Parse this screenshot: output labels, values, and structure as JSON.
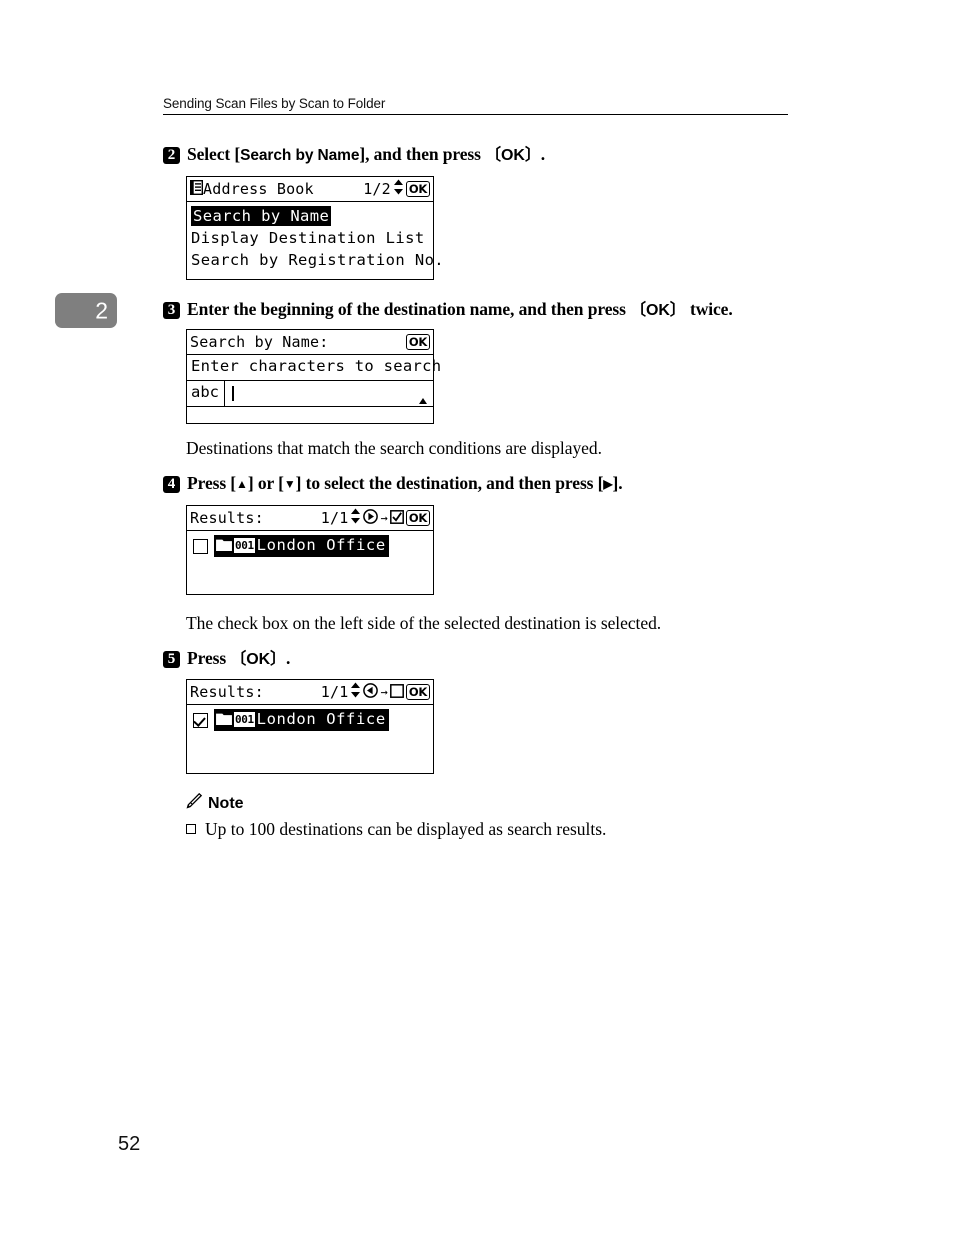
{
  "header": {
    "running_title": "Sending Scan Files by Scan to Folder"
  },
  "chapter_tab": {
    "number": "2"
  },
  "page_number": "52",
  "steps": [
    {
      "number": "2",
      "text_parts": {
        "a": "Select [",
        "b": "Search by Name",
        "c": "], and then press ",
        "d": "OK",
        "e": "."
      }
    },
    {
      "number": "3",
      "text_parts": {
        "a": "Enter the beginning of the destination name, and then press ",
        "d": "OK",
        "e": " twice."
      }
    },
    {
      "number": "4",
      "text_parts": {
        "a": "Press [",
        "up": "▲",
        "b": "] or [",
        "down": "▼",
        "c": "] to select the destination, and then press [",
        "right": "▶",
        "e": "]."
      }
    },
    {
      "number": "5",
      "text_parts": {
        "a": "Press ",
        "d": "OK",
        "e": "."
      }
    }
  ],
  "paragraphs": {
    "after_step3": "Destinations that match the search conditions are displayed.",
    "after_step4": "The check box on the left side of the selected destination is selected."
  },
  "lcd_address_book": {
    "icon": "address-book-icon",
    "title": "Address Book",
    "page_indicator": "1/2",
    "updown_icon": "up-down-arrow-icon",
    "ok_key": "OK",
    "rows": [
      {
        "label": "Search by Name",
        "selected": true
      },
      {
        "label": "Display Destination List",
        "selected": false
      },
      {
        "label": "Search by Registration No.",
        "selected": false
      }
    ]
  },
  "lcd_search_by_name": {
    "title": "Search by Name:",
    "ok_key": "OK",
    "prompt": "Enter characters to search",
    "input_mode": "abc",
    "input_value": "",
    "scroll_icon": "scroll-up-triangle-icon"
  },
  "lcd_results_unchecked": {
    "title": "Results:",
    "page_indicator": "1/1",
    "updown_icon": "up-down-arrow-icon",
    "direction_icon": "right-arrow-circle-icon",
    "arrow_to": "→",
    "target_checkbox_icon": "checked-box-icon",
    "ok_key": "OK",
    "row": {
      "checked": false,
      "folder_icon": "folder-icon",
      "number": "001",
      "name": "London Office"
    }
  },
  "lcd_results_checked": {
    "title": "Results:",
    "page_indicator": "1/1",
    "updown_icon": "up-down-arrow-icon",
    "direction_icon": "left-arrow-circle-icon",
    "arrow_to": "→",
    "target_checkbox_icon": "empty-box-icon",
    "ok_key": "OK",
    "row": {
      "checked": true,
      "folder_icon": "folder-icon",
      "number": "001",
      "name": "London Office"
    }
  },
  "note": {
    "icon": "pencil-icon",
    "title": "Note",
    "items": [
      "Up to 100 destinations can be displayed as search results."
    ]
  },
  "colors": {
    "chapter_tab_bg": "#7f7f7f",
    "text": "#000000",
    "page_bg": "#ffffff"
  }
}
